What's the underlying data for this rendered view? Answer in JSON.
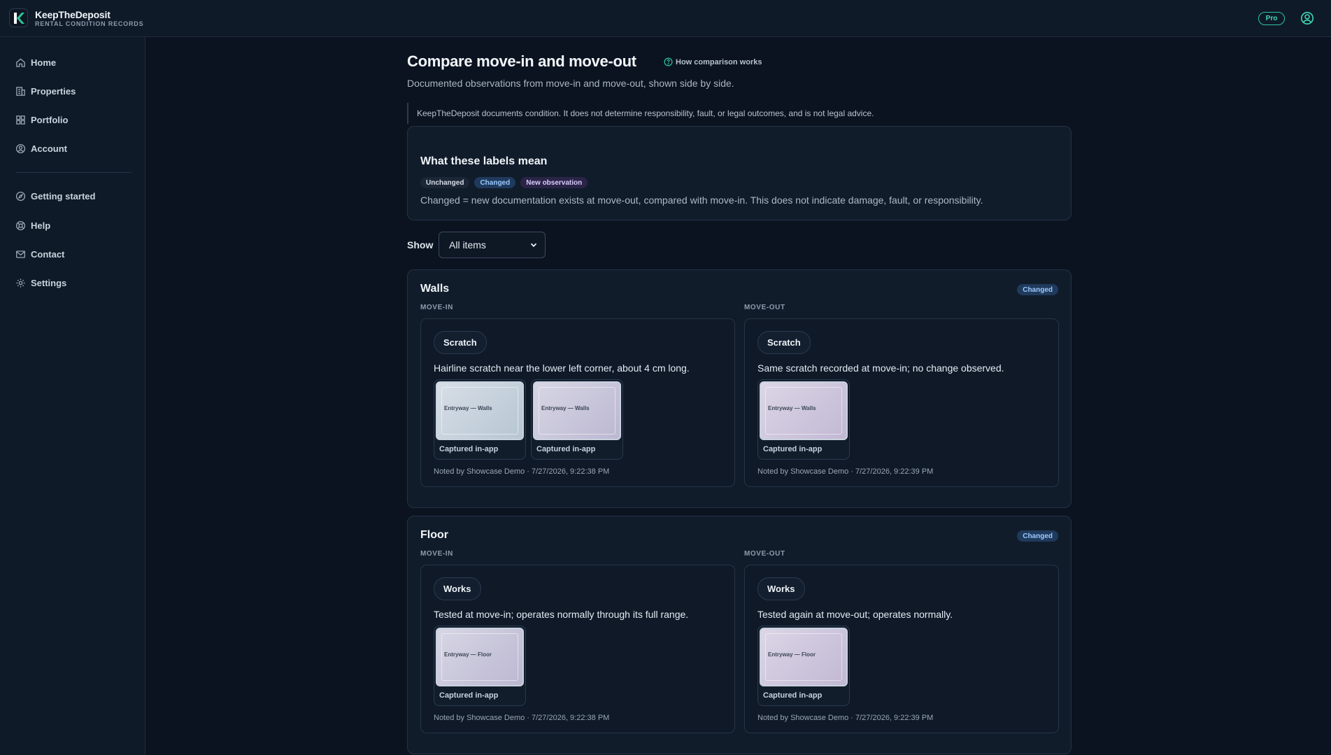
{
  "header": {
    "brand_name": "KeepTheDeposit",
    "brand_sub": "RENTAL CONDITION RECORDS",
    "plan_badge": "Pro",
    "accent_color": "#2ec4a0"
  },
  "sidebar": {
    "primary": [
      {
        "label": "Home",
        "icon": "home-icon"
      },
      {
        "label": "Properties",
        "icon": "building-icon"
      },
      {
        "label": "Portfolio",
        "icon": "grid-icon"
      },
      {
        "label": "Account",
        "icon": "user-circle-icon"
      }
    ],
    "secondary": [
      {
        "label": "Getting started",
        "icon": "compass-icon"
      },
      {
        "label": "Help",
        "icon": "lifebuoy-icon"
      },
      {
        "label": "Contact",
        "icon": "mail-icon"
      },
      {
        "label": "Settings",
        "icon": "gear-icon"
      }
    ]
  },
  "main": {
    "title": "Compare move-in and move-out",
    "how_link": "How comparison works",
    "subtitle": "Documented observations from move-in and move-out, shown side by side.",
    "disclaimer": "KeepTheDeposit documents condition. It does not determine responsibility, fault, or legal outcomes, and is not legal advice.",
    "labels_card": {
      "title": "What these labels mean",
      "chips": [
        "Unchanged",
        "Changed",
        "New observation"
      ],
      "description": "Changed = new documentation exists at move-out, compared with move-in. This does not indicate damage, fault, or responsibility."
    },
    "filter": {
      "label": "Show",
      "selected": "All items"
    }
  },
  "sections": [
    {
      "title": "Walls",
      "badge": "Changed",
      "move_in": {
        "column_label": "MOVE-IN",
        "chip": "Scratch",
        "text": "Hairline scratch near the lower left corner, about 4 cm long.",
        "photos": [
          {
            "title": "Entryway — Walls",
            "caption": "Captured in-app"
          },
          {
            "title": "Entryway — Walls",
            "caption": "Captured in-app"
          }
        ],
        "noted": "Noted by Showcase Demo · 7/27/2026, 9:22:38 PM"
      },
      "move_out": {
        "column_label": "MOVE-OUT",
        "chip": "Scratch",
        "text": "Same scratch recorded at move-in; no change observed.",
        "photos": [
          {
            "title": "Entryway — Walls",
            "caption": "Captured in-app"
          }
        ],
        "noted": "Noted by Showcase Demo · 7/27/2026, 9:22:39 PM"
      }
    },
    {
      "title": "Floor",
      "badge": "Changed",
      "move_in": {
        "column_label": "MOVE-IN",
        "chip": "Works",
        "text": "Tested at move-in; operates normally through its full range.",
        "photos": [
          {
            "title": "Entryway — Floor",
            "caption": "Captured in-app"
          }
        ],
        "noted": "Noted by Showcase Demo · 7/27/2026, 9:22:38 PM"
      },
      "move_out": {
        "column_label": "MOVE-OUT",
        "chip": "Works",
        "text": "Tested again at move-out; operates normally.",
        "photos": [
          {
            "title": "Entryway — Floor",
            "caption": "Captured in-app"
          }
        ],
        "noted": "Noted by Showcase Demo · 7/27/2026, 9:22:39 PM"
      }
    }
  ]
}
